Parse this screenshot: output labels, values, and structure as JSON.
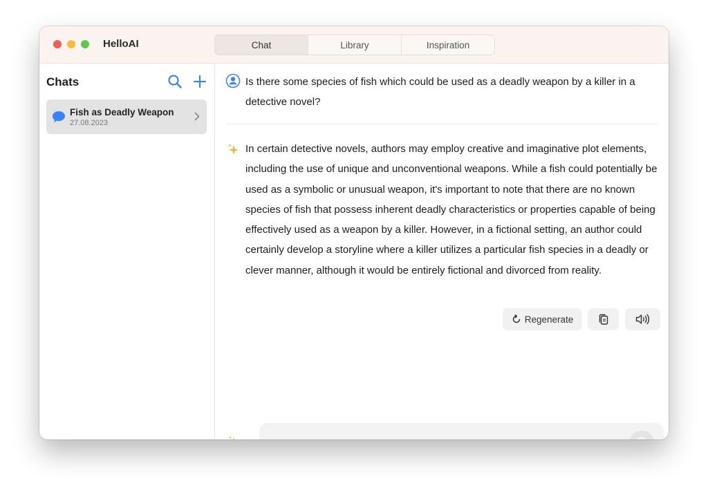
{
  "app": {
    "title": "HelloAI"
  },
  "tabs": [
    {
      "label": "Chat",
      "active": true
    },
    {
      "label": "Library",
      "active": false
    },
    {
      "label": "Inspiration",
      "active": false
    }
  ],
  "sidebar": {
    "title": "Chats",
    "items": [
      {
        "title": "Fish as Deadly Weapon",
        "date": "27.08.2023"
      }
    ]
  },
  "conversation": {
    "question": "Is there some species of fish which could be used as a deadly weapon by a killer in a detective novel?",
    "answer": "In certain detective novels, authors may employ creative and imaginative plot elements, including the use of unique and unconventional weapons. While a fish could potentially be used as a symbolic or unusual weapon, it's important to note that there are no known species of fish that possess inherent deadly characteristics or properties capable of being effectively used as a weapon by a killer. However, in a fictional setting, an author could certainly develop a storyline where a killer utilizes a particular fish species in a deadly or clever manner, although it would be entirely fictional and divorced from reality."
  },
  "actions": {
    "regenerate_label": "Regenerate"
  },
  "composer": {
    "placeholder": ""
  },
  "colors": {
    "accent": "#3b82f6",
    "sparkle": "#f2b53c",
    "active_tab": "#ece7e3"
  }
}
